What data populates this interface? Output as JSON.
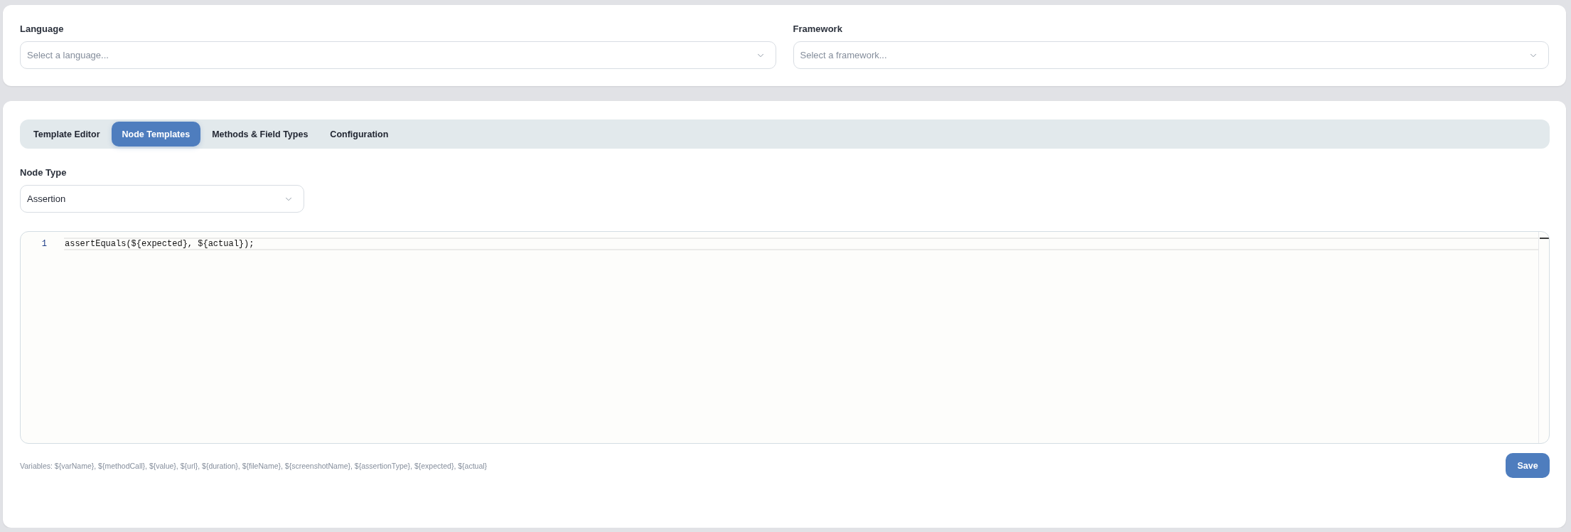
{
  "language": {
    "label": "Language",
    "placeholder": "Select a language..."
  },
  "framework": {
    "label": "Framework",
    "placeholder": "Select a framework..."
  },
  "tabs": [
    {
      "label": "Template Editor",
      "selected": false
    },
    {
      "label": "Node Templates",
      "selected": true
    },
    {
      "label": "Methods & Field Types",
      "selected": false
    },
    {
      "label": "Configuration",
      "selected": false
    }
  ],
  "node_type": {
    "label": "Node Type",
    "value": "Assertion"
  },
  "editor": {
    "lines": [
      {
        "number": "1",
        "code": "assertEquals(${expected}, ${actual});",
        "current": true
      }
    ]
  },
  "variables_hint": "Variables: ${varName}, ${methodCall}, ${value}, ${url}, ${duration}, ${fileName}, ${screenshotName}, ${assertionType}, ${expected}, ${actual}",
  "save_button": "Save"
}
